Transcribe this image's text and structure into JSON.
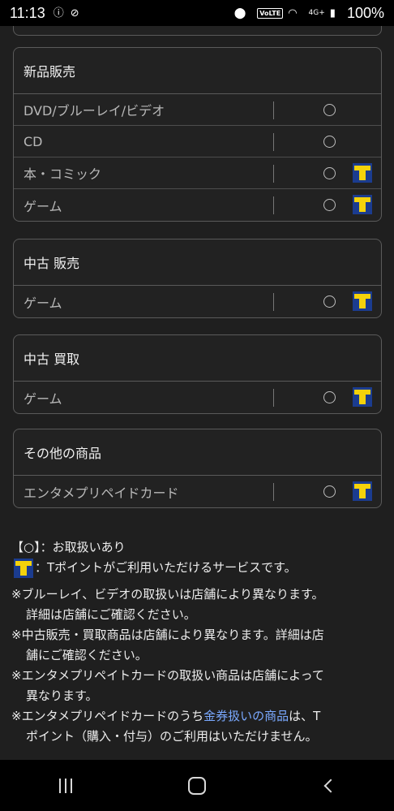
{
  "status": {
    "time": "11:13",
    "battery": "100%",
    "network": "4G+",
    "volte": "VoLTE"
  },
  "sections": [
    {
      "title": "新品販売",
      "rows": [
        {
          "label": "DVD/ブルーレイ/ビデオ",
          "available": "○",
          "tpoint": false
        },
        {
          "label": "CD",
          "available": "○",
          "tpoint": false
        },
        {
          "label": "本・コミック",
          "available": "○",
          "tpoint": true
        },
        {
          "label": "ゲーム",
          "available": "○",
          "tpoint": true
        }
      ]
    },
    {
      "title": "中古 販売",
      "rows": [
        {
          "label": "ゲーム",
          "available": "○",
          "tpoint": true
        }
      ]
    },
    {
      "title": "中古 買取",
      "rows": [
        {
          "label": "ゲーム",
          "available": "○",
          "tpoint": true
        }
      ]
    },
    {
      "title": "その他の商品",
      "rows": [
        {
          "label": "エンタメプリペイドカード",
          "available": "○",
          "tpoint": true
        }
      ]
    }
  ],
  "notes": {
    "legend_circle": "【○】：お取扱いあり",
    "legend_t": "：Tポイントがご利用いただけるサービスです。",
    "note1_a": "※ブルーレイ、ビデオの取扱いは店舗により異なります。",
    "note1_b": "詳細は店舗にご確認ください。",
    "note2_a": "※中古販売・買取商品は店舗により異なります。詳細は店",
    "note2_b": "舗にご確認ください。",
    "note3_a": "※エンタメプリペイトカードの取扱い商品は店舗によって",
    "note3_b": "異なります。",
    "note4_prefix": "※エンタメプリペイドカードのうち",
    "note4_link": "金券扱いの商品",
    "note4_suffix": "は、T",
    "note4_b": "ポイント（購入・付与）のご利用はいただけません。"
  }
}
